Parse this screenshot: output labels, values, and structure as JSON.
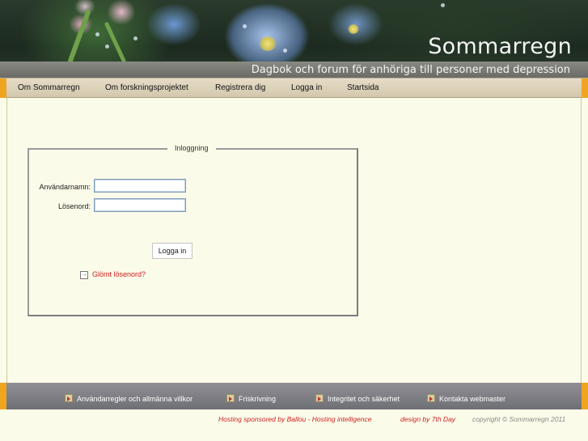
{
  "header": {
    "site_title": "Sommarregn",
    "tagline": "Dagbok och forum för anhöriga till personer med depression"
  },
  "nav": {
    "items": [
      {
        "label": "Om Sommarregn"
      },
      {
        "label": "Om forskningsprojektet"
      },
      {
        "label": "Registrera dig"
      },
      {
        "label": "Logga in"
      },
      {
        "label": "Startsida"
      }
    ]
  },
  "login": {
    "legend": "Inloggning",
    "username_label": "Användarnamn:",
    "username_value": "",
    "password_label": "Lösenord:",
    "password_value": "",
    "submit_label": "Logga in",
    "forgot_label": "Glömt lösenord?",
    "forgot_icon": "arrow-box-icon"
  },
  "footer": {
    "items": [
      {
        "label": "Användarregler och allmänna villkor",
        "icon": "arrow-icon"
      },
      {
        "label": "Friskrivning",
        "icon": "arrow-icon"
      },
      {
        "label": "Integritet och säkerhet",
        "icon": "arrow-icon"
      },
      {
        "label": "Kontakta webmaster",
        "icon": "arrow-icon"
      }
    ],
    "hosting": "Hosting sponsored by Ballou - Hosting intelligence",
    "design": "design by 7th Day",
    "copyright": "copyright © Sommarregn 2011"
  },
  "colors": {
    "accent": "#f0a520",
    "background": "#fbfbe9",
    "nav_bg": "#ddd3bb",
    "footer_bg": "#7f7f86",
    "link_red": "#cc2222"
  }
}
